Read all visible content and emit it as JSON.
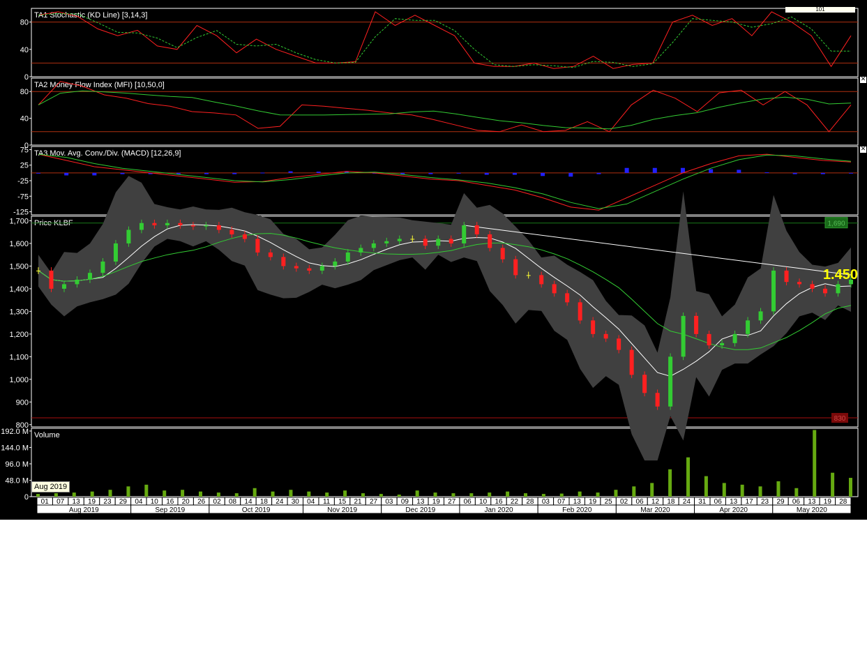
{
  "panels": [
    {
      "id": "stoch",
      "title": "TA1 Stochastic (KD Line) [3,14,3]",
      "yticks": [
        "80",
        "40",
        "0"
      ],
      "tickvals": [
        80,
        40,
        0
      ],
      "hlines": [
        80,
        20
      ]
    },
    {
      "id": "mfi",
      "title": "TA2 Money Flow Index (MFI) [10,50,0]",
      "yticks": [
        "80",
        "40",
        "0"
      ],
      "tickvals": [
        80,
        40,
        0
      ],
      "hlines": [
        80,
        20
      ]
    },
    {
      "id": "macd",
      "title": "TA3 Mov. Avg. Conv./Div. (MACD) [12,26,9]",
      "yticks": [
        "75",
        "25",
        "-25",
        "-75",
        "-125"
      ],
      "tickvals": [
        75,
        25,
        -25,
        -75,
        -125
      ],
      "hlines": [
        0
      ]
    },
    {
      "id": "price",
      "title": "Price KLBF",
      "yticks": [
        "1,700",
        "1,600",
        "1,500",
        "1,400",
        "1,300",
        "1,200",
        "1,100",
        "1,000",
        "900",
        "800"
      ],
      "tickvals": [
        1700,
        1600,
        1500,
        1400,
        1300,
        1200,
        1100,
        1000,
        900,
        800
      ],
      "hlines": [
        1690,
        830
      ]
    },
    {
      "id": "vol",
      "title": "Volume",
      "yticks": [
        "192.0 M",
        "144.0 M",
        "96.0 M",
        "48.0 M",
        "0"
      ],
      "tickvals": [
        192,
        144,
        96,
        48,
        0
      ],
      "hlines": []
    }
  ],
  "stoch_corner_label": "101",
  "price_last_label": "1.450",
  "price_high_badge": "1,690",
  "price_low_badge": "830",
  "date_tooltip": "Aug 2019",
  "day_labels": [
    "01",
    "07",
    "13",
    "19",
    "23",
    "29",
    "04",
    "10",
    "16",
    "20",
    "26",
    "02",
    "08",
    "14",
    "18",
    "24",
    "30",
    "04",
    "11",
    "15",
    "21",
    "27",
    "03",
    "09",
    "13",
    "19",
    "27",
    "06",
    "10",
    "16",
    "22",
    "28",
    "03",
    "07",
    "13",
    "19",
    "25",
    "02",
    "06",
    "12",
    "18",
    "24",
    "31",
    "06",
    "13",
    "17",
    "23",
    "29",
    "06",
    "13",
    "19",
    "28"
  ],
  "month_labels": [
    "Aug 2019",
    "Sep 2019",
    "Oct 2019",
    "Nov 2019",
    "Dec 2019",
    "Jan 2020",
    "Feb 2020",
    "Mar 2020",
    "Apr 2020",
    "May 2020"
  ],
  "colors": {
    "background": "#000000",
    "grid_line": "#b03010",
    "stoch_k": "#ff2020",
    "stoch_d": "#33cc33",
    "mfi": "#ff2020",
    "mfi_ma": "#33cc33",
    "macd": "#ff2020",
    "macd_signal": "#33cc33",
    "macd_hist": "#2020ff",
    "bb_fill": "#404040",
    "up": "#33cc33",
    "down": "#ff2020",
    "neutral": "#ffff33",
    "volume": "#66aa11",
    "last_label": "#ffff00"
  },
  "chart_data": {
    "type": "line",
    "x_start": "2019-08-01",
    "x_end": "2020-05-29",
    "price_close": [
      1480,
      1400,
      1420,
      1440,
      1470,
      1520,
      1600,
      1660,
      1690,
      1680,
      1690,
      1680,
      1675,
      1680,
      1660,
      1640,
      1620,
      1560,
      1540,
      1500,
      1490,
      1480,
      1500,
      1520,
      1560,
      1580,
      1600,
      1610,
      1620,
      1620,
      1590,
      1620,
      1600,
      1680,
      1640,
      1580,
      1530,
      1460,
      1460,
      1420,
      1380,
      1340,
      1260,
      1200,
      1180,
      1130,
      1020,
      940,
      880,
      1100,
      1280,
      1200,
      1150,
      1160,
      1200,
      1260,
      1300,
      1480,
      1430,
      1420,
      1400,
      1380,
      1420,
      1440
    ],
    "stoch": [
      90,
      95,
      88,
      70,
      60,
      68,
      45,
      40,
      75,
      60,
      35,
      55,
      40,
      30,
      20,
      20,
      22,
      95,
      75,
      90,
      75,
      60,
      20,
      15,
      15,
      20,
      12,
      15,
      30,
      12,
      18,
      20,
      80,
      90,
      75,
      85,
      60,
      95,
      80,
      60,
      15,
      60
    ],
    "mfi": [
      60,
      95,
      88,
      75,
      70,
      62,
      58,
      50,
      48,
      45,
      25,
      28,
      60,
      58,
      55,
      52,
      48,
      45,
      38,
      30,
      22,
      20,
      30,
      20,
      22,
      35,
      20,
      60,
      82,
      70,
      50,
      78,
      82,
      60,
      80,
      60,
      20,
      60
    ],
    "macd": [
      60,
      40,
      20,
      10,
      0,
      -10,
      -20,
      -30,
      -28,
      -15,
      -5,
      5,
      0,
      -10,
      -20,
      -25,
      -40,
      -55,
      -80,
      -110,
      -120,
      -80,
      -40,
      0,
      30,
      55,
      60,
      50,
      40,
      35
    ],
    "volume": [
      8,
      10,
      12,
      15,
      20,
      30,
      35,
      18,
      20,
      15,
      12,
      10,
      25,
      15,
      20,
      15,
      12,
      18,
      10,
      8,
      6,
      18,
      12,
      10,
      10,
      12,
      15,
      10,
      8,
      9,
      15,
      12,
      20,
      30,
      40,
      80,
      115,
      60,
      40,
      35,
      30,
      45,
      25,
      195,
      70,
      55
    ]
  }
}
